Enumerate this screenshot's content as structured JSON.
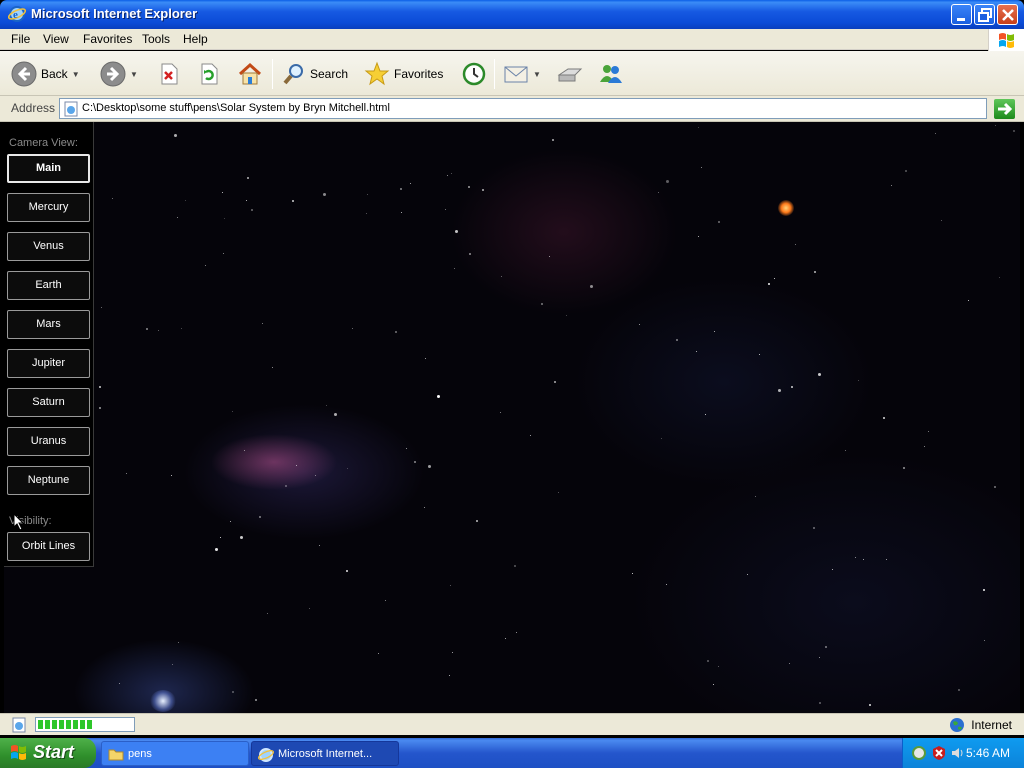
{
  "window": {
    "title": "Microsoft Internet Explorer",
    "controls": [
      "minimize-icon",
      "restore-icon",
      "close-icon"
    ]
  },
  "menu": [
    "File",
    "View",
    "Favorites",
    "Tools",
    "Help"
  ],
  "toolbar": {
    "back_label": "Back",
    "search_label": "Search",
    "favorites_label": "Favorites"
  },
  "address": {
    "label": "Address",
    "url": "C:\\Desktop\\some stuff\\pens\\Solar System by Bryn Mitchell.html"
  },
  "sidebar": {
    "camera_header": "Camera View:",
    "planets": [
      "Main",
      "Mercury",
      "Venus",
      "Earth",
      "Mars",
      "Jupiter",
      "Saturn",
      "Uranus",
      "Neptune"
    ],
    "active_planet": "Main",
    "visibility_header": "Visibility:",
    "orbit_button": "Orbit Lines"
  },
  "status": {
    "progress_fraction": 0.6,
    "zone": "Internet"
  },
  "taskbar": {
    "start_label": "Start",
    "tasks": [
      {
        "label": "pens",
        "icon": "folder-icon",
        "active": false
      },
      {
        "label": "Microsoft Internet...",
        "icon": "ie-icon",
        "active": true
      }
    ],
    "clock": "5:46 AM"
  },
  "colors": {
    "titlebar": "#0b4bd6",
    "chrome": "#ece9d8",
    "page_bg": "#05040a",
    "start_green": "#2f8f2b",
    "tray_blue": "#0c83d9"
  }
}
